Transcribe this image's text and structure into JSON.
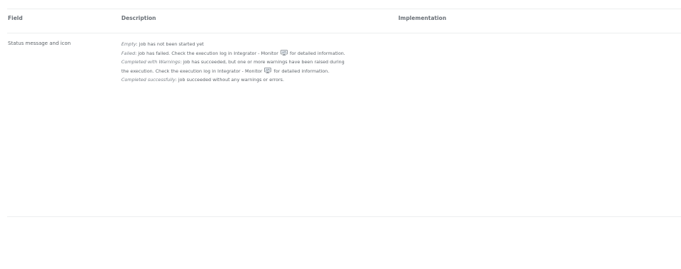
{
  "table": {
    "headers": {
      "field": "Field",
      "description": "Description",
      "implementation": "Implementation"
    },
    "rows": [
      {
        "field": "Status message and icon",
        "implementation": "",
        "description": {
          "empty_term": "Empty",
          "empty_text": ": job has not been started yet",
          "failed_term": "Failed",
          "failed_text_a": ": job has failed. Check the execution log in Integrator - Monitor",
          "failed_text_b": "for detailed information.",
          "warnings_term": "Completed with Warnings",
          "warnings_text_a": ": job has succeeded, but one or more warnings have been raised during",
          "warnings_text_b": "the execution. Check the execution log in Integrator - Monitor",
          "warnings_text_c": "for detailed information.",
          "success_term": "Completed successfully",
          "success_text": ": job succeeded without any warnings or errors."
        }
      }
    ]
  },
  "icons": {
    "monitor": "monitor-icon"
  }
}
